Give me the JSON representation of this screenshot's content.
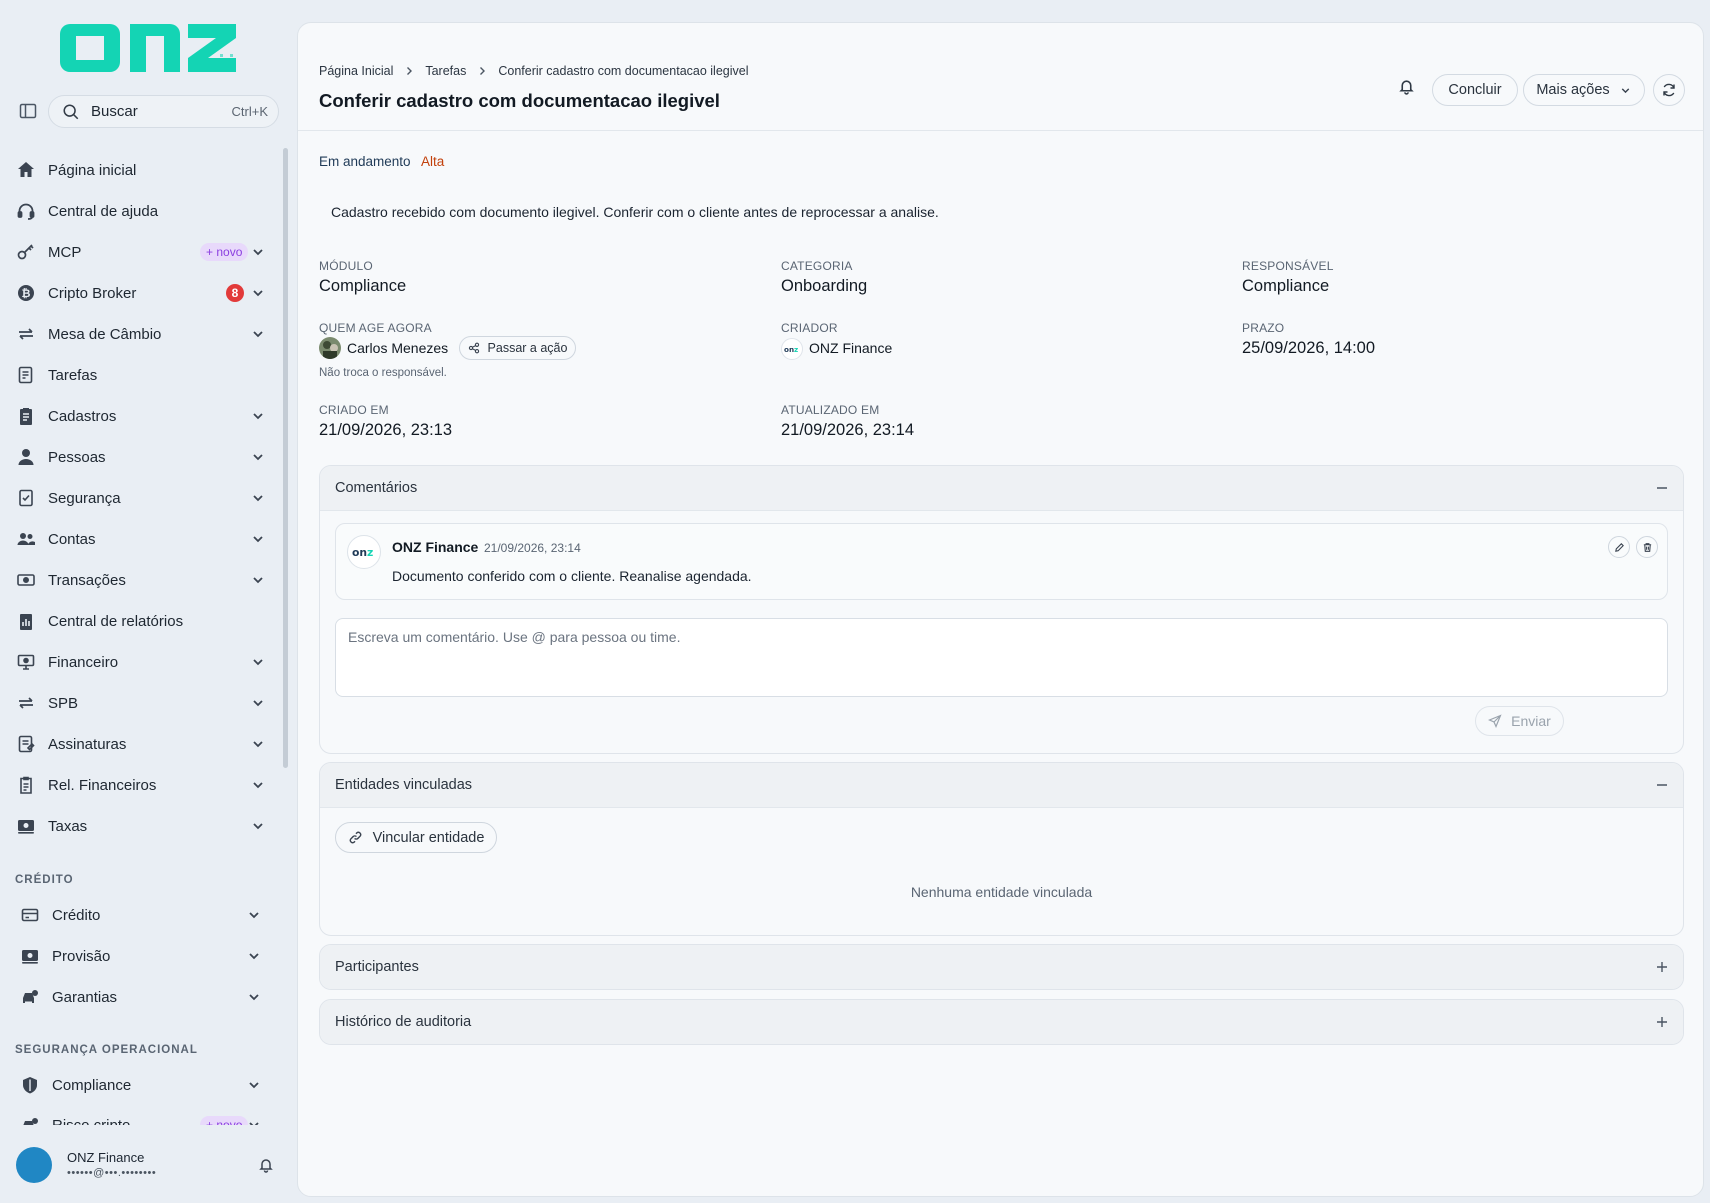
{
  "brand": {
    "logo_text": "onz",
    "accent": "#14d4b4"
  },
  "search": {
    "label": "Buscar",
    "shortcut": "Ctrl+K"
  },
  "nav": {
    "items": [
      {
        "label": "Página inicial",
        "icon": "home-icon"
      },
      {
        "label": "Central de ajuda",
        "icon": "headset-icon"
      },
      {
        "label": "MCP",
        "icon": "key-icon",
        "badge": "+ novo"
      },
      {
        "label": "Cripto Broker",
        "icon": "bitcoin-icon",
        "count": "8"
      },
      {
        "label": "Mesa de Câmbio",
        "icon": "exchange-icon"
      },
      {
        "label": "Tarefas",
        "icon": "tasks-icon"
      },
      {
        "label": "Cadastros",
        "icon": "clipboard-icon"
      },
      {
        "label": "Pessoas",
        "icon": "person-icon"
      },
      {
        "label": "Segurança",
        "icon": "shield-doc-icon"
      },
      {
        "label": "Contas",
        "icon": "users-icon"
      },
      {
        "label": "Transações",
        "icon": "money-icon"
      },
      {
        "label": "Central de relatórios",
        "icon": "report-icon"
      },
      {
        "label": "Financeiro",
        "icon": "monitor-money-icon"
      },
      {
        "label": "SPB",
        "icon": "exchange-icon"
      },
      {
        "label": "Assinaturas",
        "icon": "signature-icon"
      },
      {
        "label": "Rel. Financeiros",
        "icon": "clipboard-icon"
      },
      {
        "label": "Taxas",
        "icon": "money-icon"
      }
    ],
    "section_credito": "CRÉDITO",
    "credito_items": [
      {
        "label": "Crédito",
        "icon": "card-icon"
      },
      {
        "label": "Provisão",
        "icon": "money-icon"
      },
      {
        "label": "Garantias",
        "icon": "car-icon"
      }
    ],
    "section_seguranca": "SEGURANÇA OPERACIONAL",
    "seguranca_items": [
      {
        "label": "Compliance",
        "icon": "shield-icon"
      },
      {
        "label": "Risco cripto",
        "icon": "risk-icon",
        "badge": "+ novo"
      }
    ]
  },
  "user": {
    "name": "ONZ Finance",
    "email": "••••••@•••.••••••••"
  },
  "breadcrumb": {
    "home": "Página Inicial",
    "tasks": "Tarefas",
    "current": "Conferir cadastro com documentacao ilegivel"
  },
  "page": {
    "title": "Conferir cadastro com documentacao ilegivel"
  },
  "actions": {
    "conclude": "Concluir",
    "more": "Mais ações"
  },
  "task": {
    "status": "Em andamento",
    "priority": "Alta",
    "description": "Cadastro recebido com documento ilegivel. Conferir com o cliente antes de reprocessar a analise."
  },
  "fields": {
    "modulo_label": "MÓDULO",
    "modulo_value": "Compliance",
    "categoria_label": "CATEGORIA",
    "categoria_value": "Onboarding",
    "responsavel_label": "RESPONSÁVEL",
    "responsavel_value": "Compliance",
    "quem_label": "QUEM AGE AGORA",
    "quem_value": "Carlos Menezes",
    "quem_button": "Passar a ação",
    "quem_hint": "Não troca o responsável.",
    "criador_label": "CRIADOR",
    "criador_value": "ONZ Finance",
    "prazo_label": "PRAZO",
    "prazo_value": "25/09/2026, 14:00",
    "criado_label": "CRIADO EM",
    "criado_value": "21/09/2026, 23:13",
    "atualizado_label": "ATUALIZADO EM",
    "atualizado_value": "21/09/2026, 23:14"
  },
  "comments": {
    "title": "Comentários",
    "items": [
      {
        "author": "ONZ Finance",
        "time": "21/09/2026, 23:14",
        "text": "Documento conferido com o cliente. Reanalise agendada."
      }
    ],
    "placeholder": "Escreva um comentário. Use @ para pessoa ou time.",
    "send": "Enviar"
  },
  "entities": {
    "title": "Entidades vinculadas",
    "link_button": "Vincular entidade",
    "empty": "Nenhuma entidade vinculada"
  },
  "participants": {
    "title": "Participantes"
  },
  "audit": {
    "title": "Histórico de auditoria"
  }
}
